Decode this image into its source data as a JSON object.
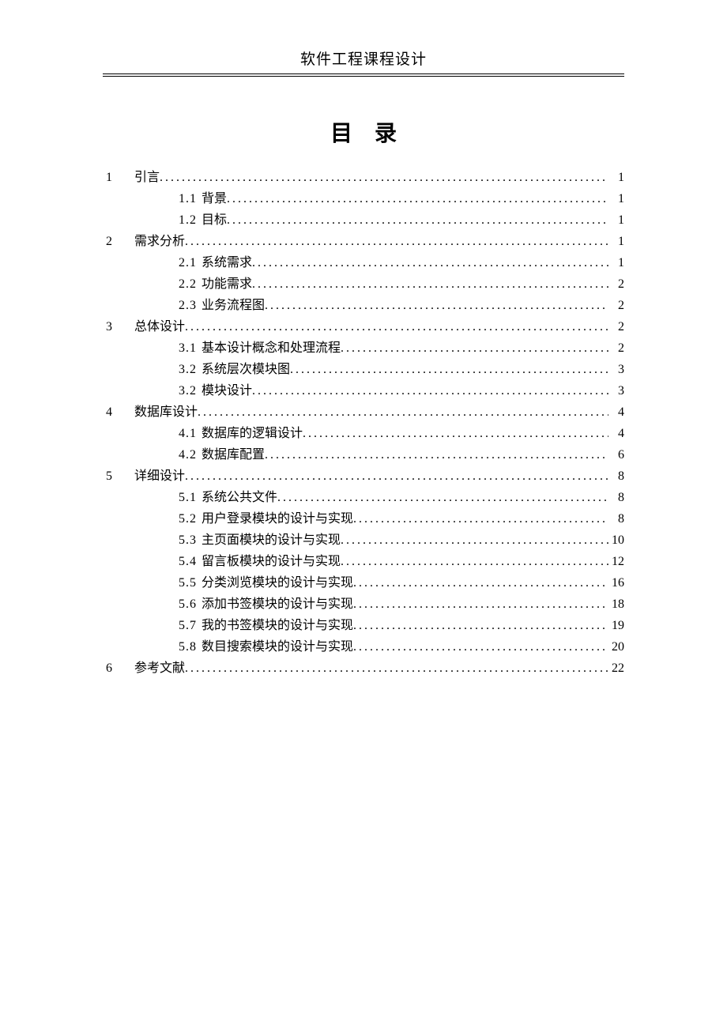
{
  "header": "软件工程课程设计",
  "title": "目录",
  "toc": [
    {
      "num": "1",
      "label": "引言",
      "page": "1",
      "level": 1
    },
    {
      "num": "1.1",
      "label": "背景",
      "page": "1",
      "level": 2
    },
    {
      "num": "1.2",
      "label": "目标",
      "page": "1",
      "level": 2
    },
    {
      "num": "2",
      "label": "需求分析",
      "page": "1",
      "level": 1
    },
    {
      "num": "2.1",
      "label": "系统需求",
      "page": "1",
      "level": 2
    },
    {
      "num": "2.2",
      "label": "功能需求",
      "page": "2",
      "level": 2
    },
    {
      "num": "2.3",
      "label": "业务流程图",
      "page": "2",
      "level": 2
    },
    {
      "num": "3",
      "label": "总体设计",
      "page": "2",
      "level": 1
    },
    {
      "num": "3.1",
      "label": "基本设计概念和处理流程",
      "page": "2",
      "level": 2
    },
    {
      "num": "3.2",
      "label": "系统层次模块图",
      "page": "3",
      "level": 2
    },
    {
      "num": "3.2",
      "label": "模块设计",
      "page": "3",
      "level": 2
    },
    {
      "num": "4",
      "label": "数据库设计",
      "page": "4",
      "level": 1
    },
    {
      "num": "4.1",
      "label": "数据库的逻辑设计",
      "page": "4",
      "level": 2
    },
    {
      "num": "4.2",
      "label": "数据库配置",
      "page": "6",
      "level": 2
    },
    {
      "num": "5",
      "label": "详细设计",
      "page": "8",
      "level": 1
    },
    {
      "num": "5.1",
      "label": "系统公共文件",
      "page": "8",
      "level": 2
    },
    {
      "num": "5.2",
      "label": "用户登录模块的设计与实现",
      "page": "8",
      "level": 2
    },
    {
      "num": "5.3",
      "label": "主页面模块的设计与实现",
      "page": "10",
      "level": 2
    },
    {
      "num": "5.4",
      "label": "留言板模块的设计与实现",
      "page": "12",
      "level": 2
    },
    {
      "num": "5.5",
      "label": "分类浏览模块的设计与实现",
      "page": "16",
      "level": 2
    },
    {
      "num": "5.6",
      "label": "添加书签模块的设计与实现",
      "page": "18",
      "level": 2
    },
    {
      "num": "5.7",
      "label": "我的书签模块的设计与实现",
      "page": "19",
      "level": 2
    },
    {
      "num": "5.8",
      "label": "数目搜索模块的设计与实现",
      "page": "20",
      "level": 2
    },
    {
      "num": "6",
      "label": "参考文献",
      "page": "22",
      "level": 1
    }
  ]
}
